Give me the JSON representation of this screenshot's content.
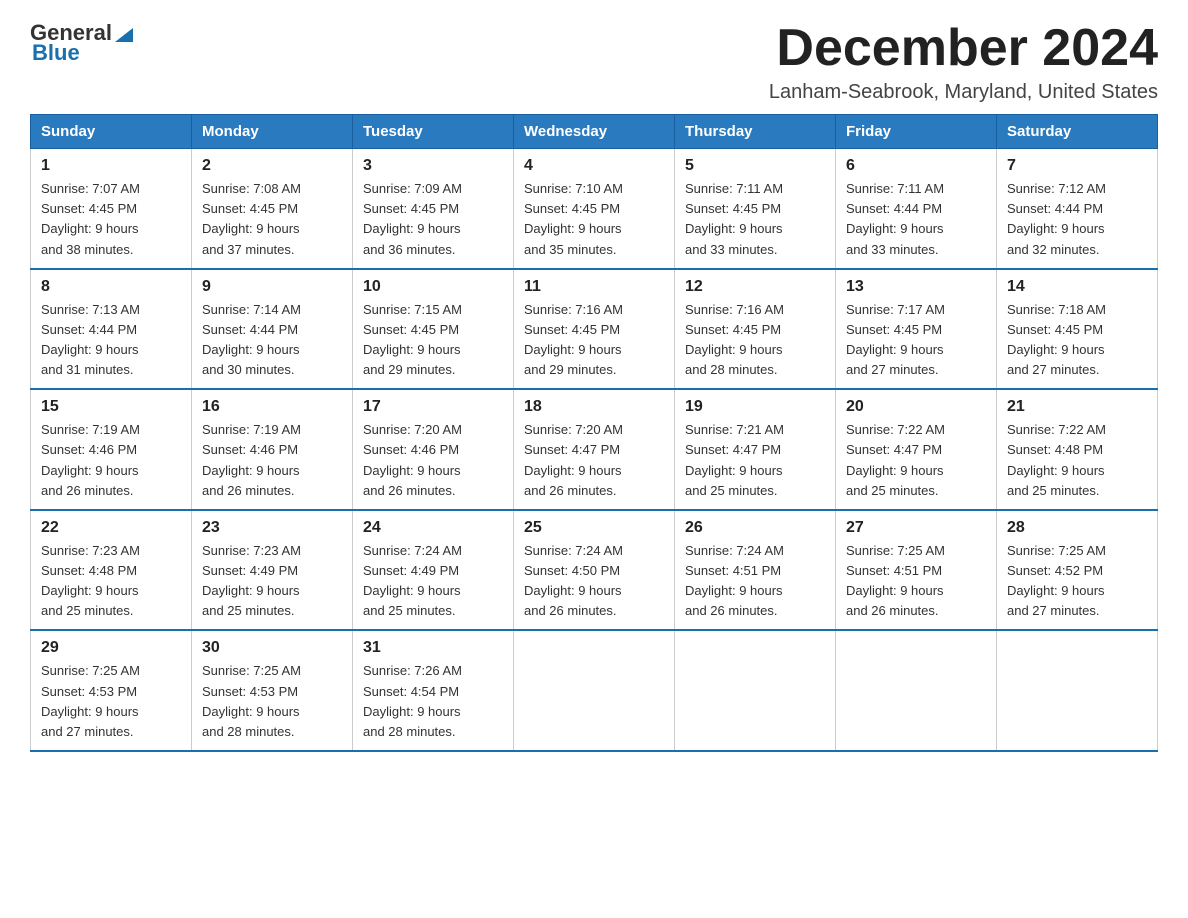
{
  "logo": {
    "general": "General",
    "blue": "Blue"
  },
  "title": {
    "month": "December 2024",
    "location": "Lanham-Seabrook, Maryland, United States"
  },
  "weekdays": [
    "Sunday",
    "Monday",
    "Tuesday",
    "Wednesday",
    "Thursday",
    "Friday",
    "Saturday"
  ],
  "weeks": [
    [
      {
        "day": "1",
        "sunrise": "7:07 AM",
        "sunset": "4:45 PM",
        "daylight": "9 hours and 38 minutes."
      },
      {
        "day": "2",
        "sunrise": "7:08 AM",
        "sunset": "4:45 PM",
        "daylight": "9 hours and 37 minutes."
      },
      {
        "day": "3",
        "sunrise": "7:09 AM",
        "sunset": "4:45 PM",
        "daylight": "9 hours and 36 minutes."
      },
      {
        "day": "4",
        "sunrise": "7:10 AM",
        "sunset": "4:45 PM",
        "daylight": "9 hours and 35 minutes."
      },
      {
        "day": "5",
        "sunrise": "7:11 AM",
        "sunset": "4:45 PM",
        "daylight": "9 hours and 33 minutes."
      },
      {
        "day": "6",
        "sunrise": "7:11 AM",
        "sunset": "4:44 PM",
        "daylight": "9 hours and 33 minutes."
      },
      {
        "day": "7",
        "sunrise": "7:12 AM",
        "sunset": "4:44 PM",
        "daylight": "9 hours and 32 minutes."
      }
    ],
    [
      {
        "day": "8",
        "sunrise": "7:13 AM",
        "sunset": "4:44 PM",
        "daylight": "9 hours and 31 minutes."
      },
      {
        "day": "9",
        "sunrise": "7:14 AM",
        "sunset": "4:44 PM",
        "daylight": "9 hours and 30 minutes."
      },
      {
        "day": "10",
        "sunrise": "7:15 AM",
        "sunset": "4:45 PM",
        "daylight": "9 hours and 29 minutes."
      },
      {
        "day": "11",
        "sunrise": "7:16 AM",
        "sunset": "4:45 PM",
        "daylight": "9 hours and 29 minutes."
      },
      {
        "day": "12",
        "sunrise": "7:16 AM",
        "sunset": "4:45 PM",
        "daylight": "9 hours and 28 minutes."
      },
      {
        "day": "13",
        "sunrise": "7:17 AM",
        "sunset": "4:45 PM",
        "daylight": "9 hours and 27 minutes."
      },
      {
        "day": "14",
        "sunrise": "7:18 AM",
        "sunset": "4:45 PM",
        "daylight": "9 hours and 27 minutes."
      }
    ],
    [
      {
        "day": "15",
        "sunrise": "7:19 AM",
        "sunset": "4:46 PM",
        "daylight": "9 hours and 26 minutes."
      },
      {
        "day": "16",
        "sunrise": "7:19 AM",
        "sunset": "4:46 PM",
        "daylight": "9 hours and 26 minutes."
      },
      {
        "day": "17",
        "sunrise": "7:20 AM",
        "sunset": "4:46 PM",
        "daylight": "9 hours and 26 minutes."
      },
      {
        "day": "18",
        "sunrise": "7:20 AM",
        "sunset": "4:47 PM",
        "daylight": "9 hours and 26 minutes."
      },
      {
        "day": "19",
        "sunrise": "7:21 AM",
        "sunset": "4:47 PM",
        "daylight": "9 hours and 25 minutes."
      },
      {
        "day": "20",
        "sunrise": "7:22 AM",
        "sunset": "4:47 PM",
        "daylight": "9 hours and 25 minutes."
      },
      {
        "day": "21",
        "sunrise": "7:22 AM",
        "sunset": "4:48 PM",
        "daylight": "9 hours and 25 minutes."
      }
    ],
    [
      {
        "day": "22",
        "sunrise": "7:23 AM",
        "sunset": "4:48 PM",
        "daylight": "9 hours and 25 minutes."
      },
      {
        "day": "23",
        "sunrise": "7:23 AM",
        "sunset": "4:49 PM",
        "daylight": "9 hours and 25 minutes."
      },
      {
        "day": "24",
        "sunrise": "7:24 AM",
        "sunset": "4:49 PM",
        "daylight": "9 hours and 25 minutes."
      },
      {
        "day": "25",
        "sunrise": "7:24 AM",
        "sunset": "4:50 PM",
        "daylight": "9 hours and 26 minutes."
      },
      {
        "day": "26",
        "sunrise": "7:24 AM",
        "sunset": "4:51 PM",
        "daylight": "9 hours and 26 minutes."
      },
      {
        "day": "27",
        "sunrise": "7:25 AM",
        "sunset": "4:51 PM",
        "daylight": "9 hours and 26 minutes."
      },
      {
        "day": "28",
        "sunrise": "7:25 AM",
        "sunset": "4:52 PM",
        "daylight": "9 hours and 27 minutes."
      }
    ],
    [
      {
        "day": "29",
        "sunrise": "7:25 AM",
        "sunset": "4:53 PM",
        "daylight": "9 hours and 27 minutes."
      },
      {
        "day": "30",
        "sunrise": "7:25 AM",
        "sunset": "4:53 PM",
        "daylight": "9 hours and 28 minutes."
      },
      {
        "day": "31",
        "sunrise": "7:26 AM",
        "sunset": "4:54 PM",
        "daylight": "9 hours and 28 minutes."
      },
      null,
      null,
      null,
      null
    ]
  ],
  "labels": {
    "sunrise": "Sunrise:",
    "sunset": "Sunset:",
    "daylight": "Daylight:"
  }
}
